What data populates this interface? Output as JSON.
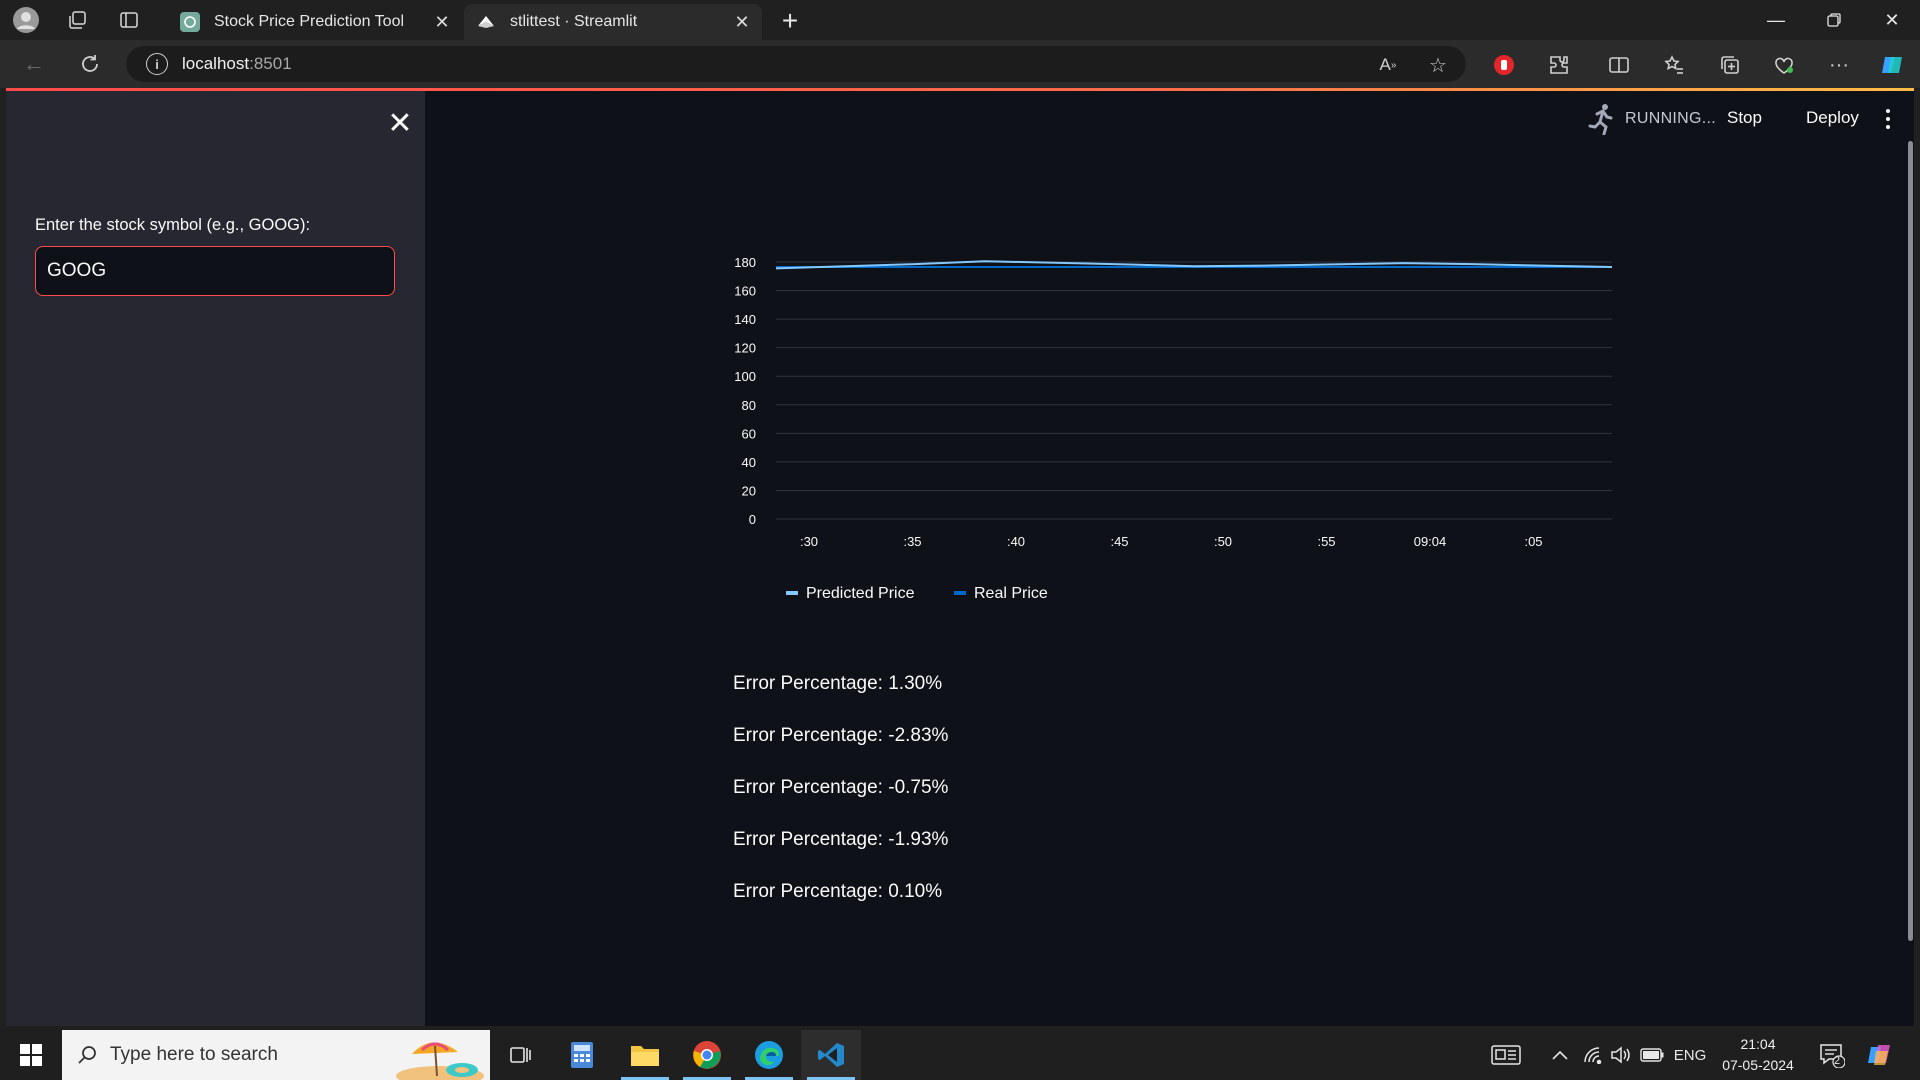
{
  "browser": {
    "tabs": [
      {
        "title": "Stock Price Prediction Tool",
        "active": false
      },
      {
        "title": "stlittest · Streamlit",
        "active": true
      }
    ],
    "address": {
      "host": "localhost",
      "port": ":8501"
    }
  },
  "app": {
    "status": "RUNNING...",
    "stop_label": "Stop",
    "deploy_label": "Deploy",
    "sidebar": {
      "input_label": "Enter the stock symbol (e.g., GOOG):",
      "input_value": "GOOG"
    },
    "errors": [
      "Error Percentage: 1.30%",
      "Error Percentage: -2.83%",
      "Error Percentage: -0.75%",
      "Error Percentage: -1.93%",
      "Error Percentage: 0.10%"
    ]
  },
  "chart_data": {
    "type": "line",
    "title": "",
    "xlabel": "",
    "ylabel": "",
    "ylim": [
      0,
      180
    ],
    "yticks": [
      0,
      20,
      40,
      60,
      80,
      100,
      120,
      140,
      160,
      180
    ],
    "x_tick_labels": [
      ":30",
      ":35",
      ":40",
      ":45",
      ":50",
      ":55",
      "09:04",
      ":05"
    ],
    "grid": true,
    "legend": "bottom-left",
    "series": [
      {
        "name": "Predicted Price",
        "color": "#83c9ff",
        "values": [
          175.5,
          177,
          178.5,
          180.5,
          179.5,
          178.3,
          177,
          177.5,
          178.3,
          179.2,
          178.5,
          177.5,
          176.5
        ]
      },
      {
        "name": "Real Price",
        "color": "#0068c9",
        "values": [
          176.5,
          176.5,
          176.5,
          176.5,
          176.5,
          176.5,
          176.5,
          176.5,
          176.5,
          176.5,
          176.5,
          176.5,
          176.5
        ]
      }
    ]
  },
  "taskbar": {
    "search_placeholder": "Type here to search",
    "language": "ENG",
    "time": "21:04",
    "date": "07-05-2024",
    "notifications": "2"
  },
  "colors": {
    "accent": "#ff4b4b",
    "app_background": "#0e1117",
    "sidebar_background": "#262730"
  }
}
